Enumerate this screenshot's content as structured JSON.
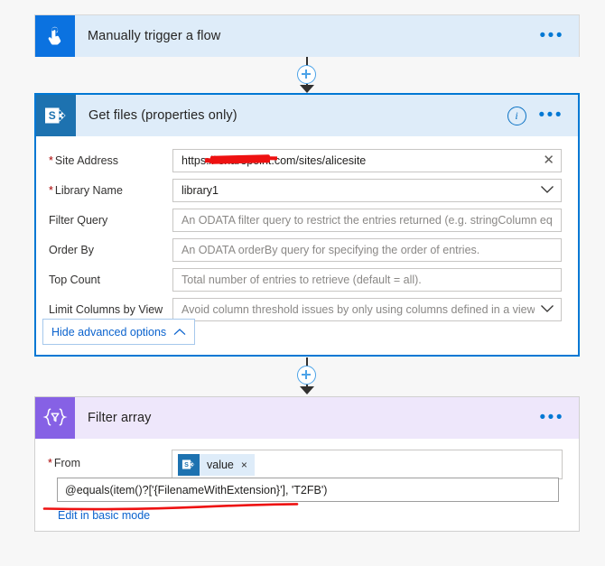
{
  "canvas": {
    "background_color": "#f7f7f7",
    "accent_color": "#0078d4"
  },
  "trigger_card": {
    "title": "Manually trigger a flow",
    "icon": "tap-hand-icon",
    "icon_background": "#0b72e0",
    "header_background": "#deecf9",
    "more_label": "•••"
  },
  "sharepoint_card": {
    "title": "Get files (properties only)",
    "icon": "sharepoint-icon",
    "icon_background": "#1d72b0",
    "header_background": "#deecf9",
    "selected_border_color": "#0078d4",
    "info_label": "i",
    "more_label": "•••",
    "fields": [
      {
        "label": "Site Address",
        "required": true,
        "value": "https://              sharepoint.com/sites/alicesite",
        "value_redacted": true,
        "control": "clear",
        "control_glyph": "✕",
        "is_placeholder": false
      },
      {
        "label": "Library Name",
        "required": true,
        "value": "library1",
        "value_redacted": false,
        "control": "dropdown",
        "is_placeholder": false
      },
      {
        "label": "Filter Query",
        "required": false,
        "value": "An ODATA filter query to restrict the entries returned (e.g. stringColumn eq 'st",
        "value_redacted": false,
        "control": "none",
        "is_placeholder": true
      },
      {
        "label": "Order By",
        "required": false,
        "value": "An ODATA orderBy query for specifying the order of entries.",
        "value_redacted": false,
        "control": "none",
        "is_placeholder": true
      },
      {
        "label": "Top Count",
        "required": false,
        "value": "Total number of entries to retrieve (default = all).",
        "value_redacted": false,
        "control": "none",
        "is_placeholder": true
      },
      {
        "label": "Limit Columns by View",
        "required": false,
        "value": "Avoid column threshold issues by only using columns defined in a view",
        "value_redacted": false,
        "control": "dropdown",
        "is_placeholder": true
      }
    ],
    "advanced_options_button": {
      "label": "Hide advanced options",
      "chevron": "chevron-up-icon"
    }
  },
  "filter_array_card": {
    "title": "Filter array",
    "icon": "filter-array-icon",
    "icon_background": "#8661e5",
    "header_background": "#eee7fb",
    "more_label": "•••",
    "from_label": "From",
    "from_required": true,
    "token": {
      "icon": "sharepoint-icon",
      "label": "value",
      "remove_glyph": "×"
    },
    "expression": "@equals(item()?['{FilenameWithExtension}'], 'T2FB')",
    "expression_annotated": true,
    "annotation_color": "#ee1111",
    "basic_mode_link": "Edit in basic mode"
  },
  "connectors": [
    {
      "name": "connector-trigger-to-sharepoint",
      "has_plus": true,
      "has_arrow": true
    },
    {
      "name": "connector-sharepoint-to-filter",
      "has_plus": true,
      "has_arrow": true
    }
  ]
}
